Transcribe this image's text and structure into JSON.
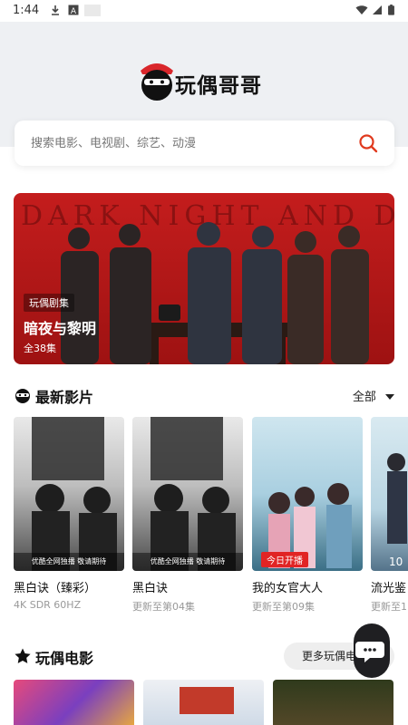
{
  "status_bar": {
    "time": "1:44"
  },
  "header": {
    "app_name": "玩偶哥哥"
  },
  "search": {
    "placeholder": "搜索电影、电视剧、综艺、动漫"
  },
  "banner": {
    "background_text": "DARK NIGHT AND DAWN",
    "tag": "玩偶剧集",
    "title": "暗夜与黎明",
    "episodes": "全38集"
  },
  "latest": {
    "title": "最新影片",
    "filter_label": "全部",
    "items": [
      {
        "title": "黑白诀（臻彩）",
        "subtitle": "4K SDR 60HZ",
        "overlay": "优酷全网独播 敬请期待"
      },
      {
        "title": "黑白诀",
        "subtitle": "更新至第04集",
        "overlay": "优酷全网独播 敬请期待"
      },
      {
        "title": "我的女官大人",
        "subtitle": "更新至第09集",
        "overlay": "今日开播"
      },
      {
        "title": "流光鉴",
        "subtitle": "更新至1",
        "overlay": "10"
      }
    ]
  },
  "movies": {
    "title": "玩偶电影",
    "more_label": "更多玩偶电"
  },
  "colors": {
    "accent": "#e03a1e",
    "banner_red": "#c41d1d",
    "fab": "#1f1f22"
  }
}
